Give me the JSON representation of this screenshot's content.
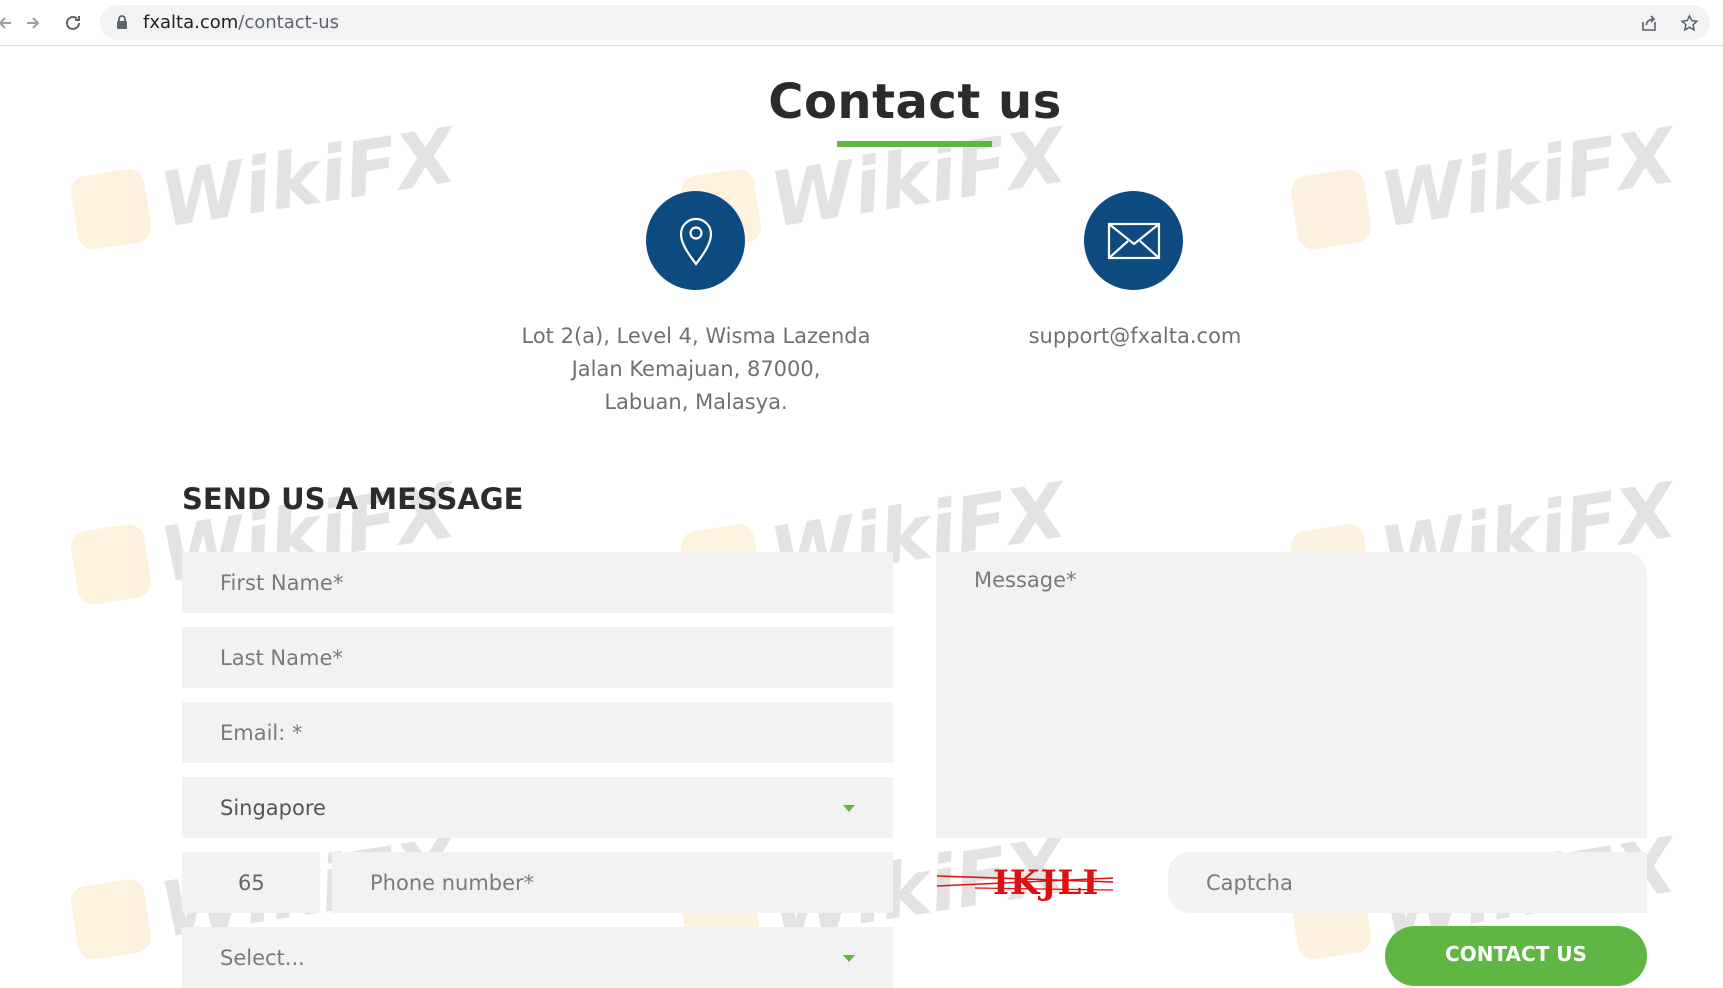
{
  "browser": {
    "url_domain": "fxalta.com",
    "url_path": "/contact-us"
  },
  "page": {
    "title": "Contact us"
  },
  "address": {
    "line1": "Lot 2(a), Level 4, Wisma Lazenda",
    "line2": "Jalan Kemajuan, 87000,",
    "line3": "Labuan, Malasya."
  },
  "email": {
    "text": "support@fxalta.com"
  },
  "form": {
    "heading": "SEND US A MESSAGE",
    "first_name_placeholder": "First Name*",
    "last_name_placeholder": "Last Name*",
    "email_placeholder": "Email: *",
    "country_value": "Singapore",
    "phone_code_value": "65",
    "phone_placeholder": "Phone number*",
    "select_placeholder": "Select...",
    "message_placeholder": "Message*",
    "captcha_image_text": "IKJLI",
    "captcha_placeholder": "Captcha",
    "submit_label": "CONTACT US"
  },
  "watermark": {
    "text": "WikiFX"
  },
  "colors": {
    "accent_green": "#5fb642",
    "icon_blue": "#0c4a80",
    "captcha_red": "#d11"
  },
  "icons": [
    "back-icon",
    "forward-icon",
    "reload-icon",
    "lock-icon",
    "share-icon",
    "star-icon",
    "location-pin-icon",
    "envelope-icon",
    "dropdown-caret-icon"
  ]
}
